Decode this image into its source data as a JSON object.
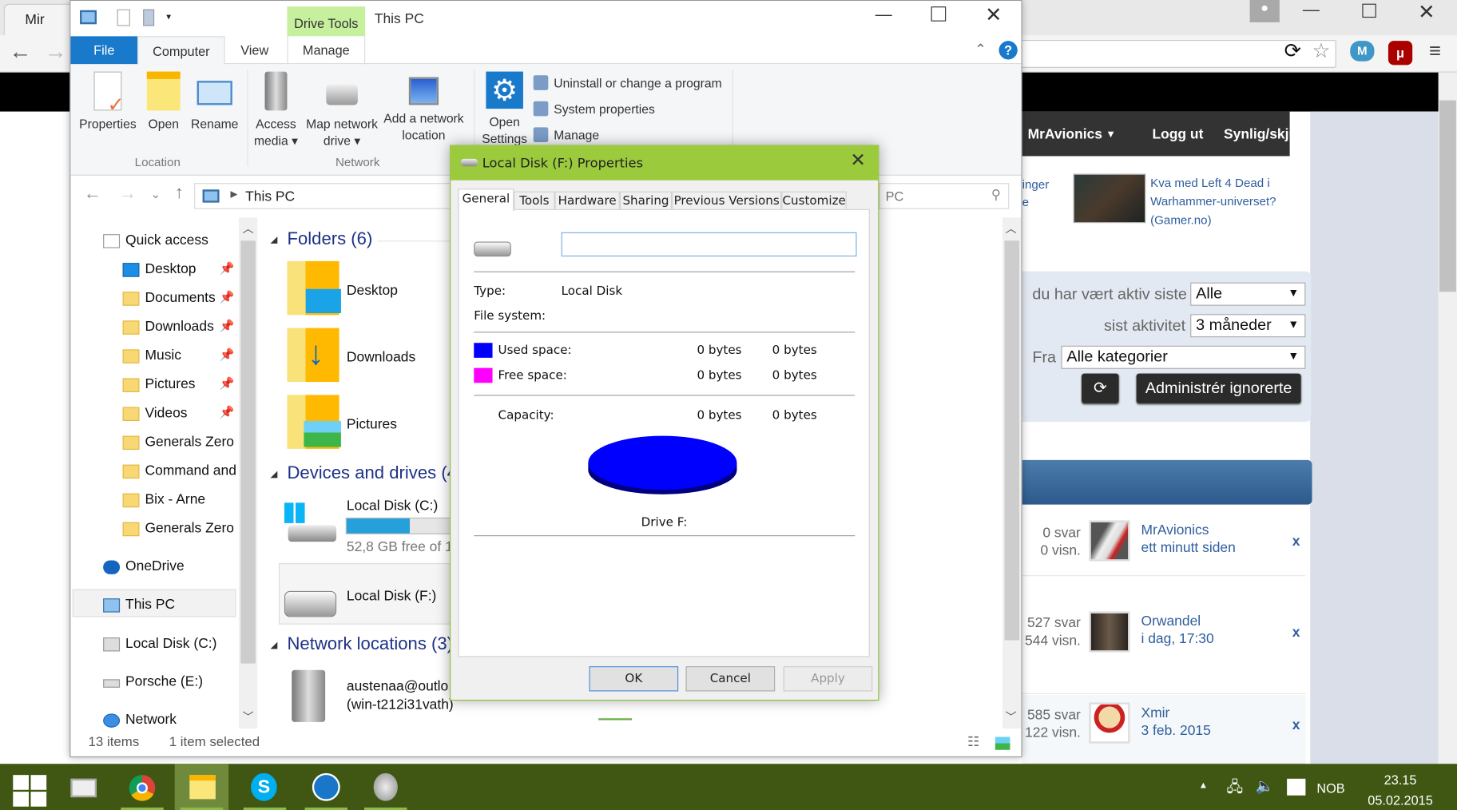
{
  "browser": {
    "tab_title": "Mir",
    "web": {
      "nav": {
        "user": "MrAvionics",
        "logout": "Logg ut",
        "visibility": "Synlig/skjult"
      },
      "sidebar_partial": [
        "inger",
        "e"
      ],
      "article": {
        "title_line1": "Kva med Left 4 Dead i",
        "title_line2": "Warhammer-universet?",
        "source": "(Gamer.no)"
      },
      "filter": {
        "active_label": "du har vært aktiv siste",
        "active_value": "Alle",
        "last_label": "sist aktivitet",
        "last_value": "3 måneder",
        "from_label": "Fra",
        "from_value": "Alle kategorier",
        "refresh_icon": "refresh-icon",
        "manage_button": "Administrér ignorerte"
      },
      "threads": [
        {
          "replies": "0 svar",
          "views": "0 visn.",
          "user": "MrAvionics",
          "time": "ett minutt siden",
          "remove": "x"
        },
        {
          "replies": "527 svar",
          "views": "544 visn.",
          "user": "Orwandel",
          "time": "i dag, 17:30",
          "remove": "x"
        },
        {
          "replies": "585 svar",
          "views": "122 visn.",
          "user": "Xmir",
          "time": "3 feb. 2015",
          "remove": "x"
        }
      ]
    }
  },
  "explorer": {
    "title": "This PC",
    "context_tab": "Drive Tools",
    "tabs": [
      "File",
      "Computer",
      "View",
      "Manage"
    ],
    "ribbon": {
      "location": {
        "label": "Location",
        "buttons": [
          "Properties",
          "Open",
          "Rename"
        ]
      },
      "network": {
        "label": "Network",
        "access_media": [
          "Access",
          "media ▾"
        ],
        "map_drive": [
          "Map network",
          "drive ▾"
        ],
        "add_location": [
          "Add a network",
          "location"
        ]
      },
      "system": {
        "open_settings": [
          "Open",
          "Settings"
        ],
        "items": [
          "Uninstall or change a program",
          "System properties",
          "Manage"
        ]
      }
    },
    "address": "This PC",
    "search_placeholder": "PC",
    "nav": {
      "quick_access": "Quick access",
      "items": [
        "Desktop",
        "Documents",
        "Downloads",
        "Music",
        "Pictures",
        "Videos",
        "Generals Zero",
        "Command and",
        "Bix - Arne",
        "Generals Zero"
      ],
      "onedrive": "OneDrive",
      "this_pc": "This PC",
      "local_c": "Local Disk (C:)",
      "porsche": "Porsche (E:)",
      "network": "Network"
    },
    "content": {
      "folders_header": "Folders (6)",
      "folders": [
        "Desktop",
        "Downloads",
        "Pictures"
      ],
      "devices_header": "Devices and drives (4",
      "drive_c": {
        "name": "Local Disk (C:)",
        "free": "52,8 GB free of 1",
        "used_fraction": 0.6
      },
      "drive_f": {
        "name": "Local Disk (F:)"
      },
      "network_header": "Network locations (3)",
      "network_item": [
        "austenaa@outlo",
        "(win-t212i31vath)"
      ]
    },
    "status": {
      "items": "13 items",
      "selected": "1 item selected"
    }
  },
  "dialog": {
    "title": "Local Disk (F:) Properties",
    "tabs": [
      "General",
      "Tools",
      "Hardware",
      "Sharing",
      "Previous Versions",
      "Customize"
    ],
    "label_value": "",
    "type_label": "Type:",
    "type_value": "Local Disk",
    "fs_label": "File system:",
    "used_label": "Used space:",
    "used_bytes": "0 bytes",
    "used_bytes2": "0 bytes",
    "free_label": "Free space:",
    "free_bytes": "0 bytes",
    "free_bytes2": "0 bytes",
    "capacity_label": "Capacity:",
    "capacity_bytes": "0 bytes",
    "capacity_bytes2": "0 bytes",
    "drive_label": "Drive F:",
    "ok": "OK",
    "cancel": "Cancel",
    "apply": "Apply",
    "colors": {
      "used": "#0000ff",
      "free": "#ff00ff"
    }
  },
  "taskbar": {
    "language": "NOB",
    "time": "23.15",
    "date": "05.02.2015"
  }
}
